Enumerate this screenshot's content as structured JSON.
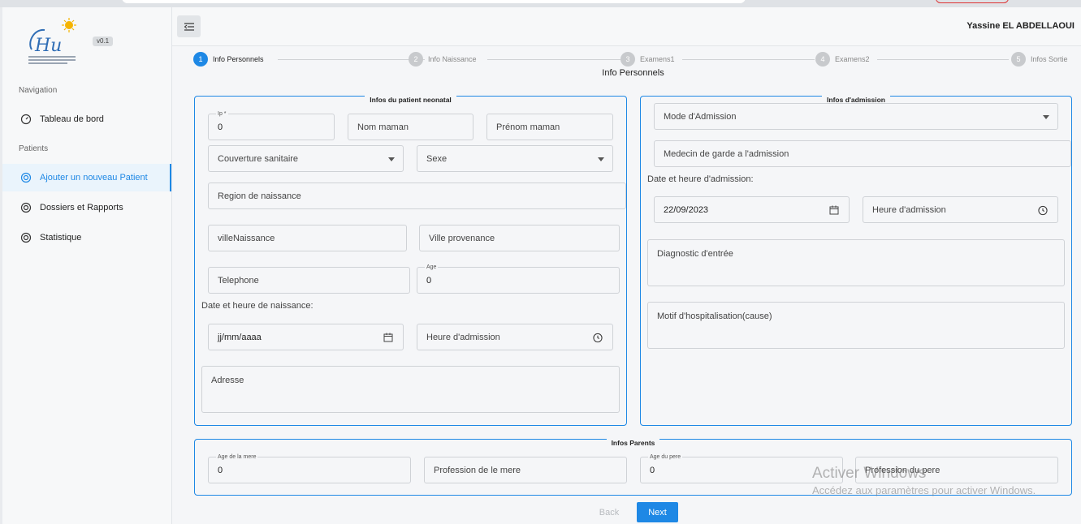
{
  "sidebar": {
    "version": "v0.1",
    "nav_section": "Navigation",
    "patients_section": "Patients",
    "items": [
      {
        "label": "Tableau de bord",
        "icon": "dashboard-icon"
      },
      {
        "label": "Ajouter un nouveau Patient",
        "icon": "spiral-icon",
        "active": true
      },
      {
        "label": "Dossiers et Rapports",
        "icon": "spiral-icon"
      },
      {
        "label": "Statistique",
        "icon": "spiral-icon"
      }
    ]
  },
  "header": {
    "username": "Yassine EL ABDELLAOUI"
  },
  "stepper": {
    "steps": [
      {
        "num": "1",
        "label": "Info Personnels",
        "active": true
      },
      {
        "num": "2",
        "label": "Info Naissance"
      },
      {
        "num": "3",
        "label": "Examens1"
      },
      {
        "num": "4",
        "label": "Examens2"
      },
      {
        "num": "5",
        "label": "Infos Sortie"
      }
    ],
    "current_title": "Info Personnels"
  },
  "patient": {
    "legend": "Infos du patient neonatal",
    "ip": {
      "label": "Ip *",
      "value": "0"
    },
    "nom_maman": {
      "placeholder": "Nom maman"
    },
    "prenom_maman": {
      "placeholder": "Prénom maman"
    },
    "couverture": {
      "placeholder": "Couverture sanitaire"
    },
    "sexe": {
      "placeholder": "Sexe"
    },
    "region": {
      "placeholder": "Region de naissance"
    },
    "ville_naissance": {
      "placeholder": "villeNaissance"
    },
    "ville_provenance": {
      "placeholder": "Ville provenance"
    },
    "telephone": {
      "placeholder": "Telephone"
    },
    "age": {
      "label": "Age",
      "value": "0"
    },
    "date_label": "Date et heure de naissance:",
    "date": {
      "value": "jj/mm/aaaa"
    },
    "heure": {
      "placeholder": "Heure d'admission"
    },
    "adresse": {
      "placeholder": "Adresse"
    }
  },
  "admission": {
    "legend": "Infos d'admission",
    "mode": {
      "placeholder": "Mode d'Admission"
    },
    "medecin": {
      "placeholder": "Medecin de garde a l'admission"
    },
    "date_label": "Date et heure d'admission:",
    "date": {
      "value": "22/09/2023"
    },
    "heure": {
      "placeholder": "Heure d'admission"
    },
    "diagnostic": {
      "placeholder": "Diagnostic d'entrée"
    },
    "motif": {
      "placeholder": "Motif d'hospitalisation(cause)"
    }
  },
  "parents": {
    "legend": "Infos Parents",
    "age_mere": {
      "label": "Age de la mere",
      "value": "0"
    },
    "profession_mere": {
      "placeholder": "Profession de le mere"
    },
    "age_pere": {
      "label": "Age du pere",
      "value": "0"
    },
    "profession_pere": {
      "placeholder": "Profession du pere"
    }
  },
  "actions": {
    "back": "Back",
    "next": "Next"
  },
  "watermark": {
    "line1": "Activer Windows",
    "line2": "Accédez aux paramètres pour activer Windows."
  },
  "colors": {
    "accent": "#1e88e5"
  }
}
